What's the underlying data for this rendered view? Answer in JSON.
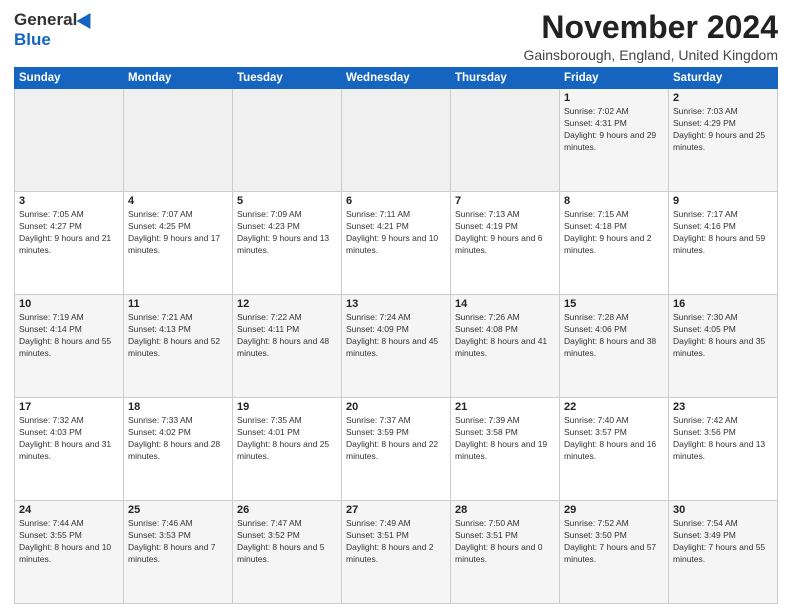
{
  "logo": {
    "general": "General",
    "blue": "Blue"
  },
  "header": {
    "month_title": "November 2024",
    "location": "Gainsborough, England, United Kingdom"
  },
  "days_of_week": [
    "Sunday",
    "Monday",
    "Tuesday",
    "Wednesday",
    "Thursday",
    "Friday",
    "Saturday"
  ],
  "weeks": [
    [
      {
        "day": "",
        "info": ""
      },
      {
        "day": "",
        "info": ""
      },
      {
        "day": "",
        "info": ""
      },
      {
        "day": "",
        "info": ""
      },
      {
        "day": "",
        "info": ""
      },
      {
        "day": "1",
        "info": "Sunrise: 7:02 AM\nSunset: 4:31 PM\nDaylight: 9 hours and 29 minutes."
      },
      {
        "day": "2",
        "info": "Sunrise: 7:03 AM\nSunset: 4:29 PM\nDaylight: 9 hours and 25 minutes."
      }
    ],
    [
      {
        "day": "3",
        "info": "Sunrise: 7:05 AM\nSunset: 4:27 PM\nDaylight: 9 hours and 21 minutes."
      },
      {
        "day": "4",
        "info": "Sunrise: 7:07 AM\nSunset: 4:25 PM\nDaylight: 9 hours and 17 minutes."
      },
      {
        "day": "5",
        "info": "Sunrise: 7:09 AM\nSunset: 4:23 PM\nDaylight: 9 hours and 13 minutes."
      },
      {
        "day": "6",
        "info": "Sunrise: 7:11 AM\nSunset: 4:21 PM\nDaylight: 9 hours and 10 minutes."
      },
      {
        "day": "7",
        "info": "Sunrise: 7:13 AM\nSunset: 4:19 PM\nDaylight: 9 hours and 6 minutes."
      },
      {
        "day": "8",
        "info": "Sunrise: 7:15 AM\nSunset: 4:18 PM\nDaylight: 9 hours and 2 minutes."
      },
      {
        "day": "9",
        "info": "Sunrise: 7:17 AM\nSunset: 4:16 PM\nDaylight: 8 hours and 59 minutes."
      }
    ],
    [
      {
        "day": "10",
        "info": "Sunrise: 7:19 AM\nSunset: 4:14 PM\nDaylight: 8 hours and 55 minutes."
      },
      {
        "day": "11",
        "info": "Sunrise: 7:21 AM\nSunset: 4:13 PM\nDaylight: 8 hours and 52 minutes."
      },
      {
        "day": "12",
        "info": "Sunrise: 7:22 AM\nSunset: 4:11 PM\nDaylight: 8 hours and 48 minutes."
      },
      {
        "day": "13",
        "info": "Sunrise: 7:24 AM\nSunset: 4:09 PM\nDaylight: 8 hours and 45 minutes."
      },
      {
        "day": "14",
        "info": "Sunrise: 7:26 AM\nSunset: 4:08 PM\nDaylight: 8 hours and 41 minutes."
      },
      {
        "day": "15",
        "info": "Sunrise: 7:28 AM\nSunset: 4:06 PM\nDaylight: 8 hours and 38 minutes."
      },
      {
        "day": "16",
        "info": "Sunrise: 7:30 AM\nSunset: 4:05 PM\nDaylight: 8 hours and 35 minutes."
      }
    ],
    [
      {
        "day": "17",
        "info": "Sunrise: 7:32 AM\nSunset: 4:03 PM\nDaylight: 8 hours and 31 minutes."
      },
      {
        "day": "18",
        "info": "Sunrise: 7:33 AM\nSunset: 4:02 PM\nDaylight: 8 hours and 28 minutes."
      },
      {
        "day": "19",
        "info": "Sunrise: 7:35 AM\nSunset: 4:01 PM\nDaylight: 8 hours and 25 minutes."
      },
      {
        "day": "20",
        "info": "Sunrise: 7:37 AM\nSunset: 3:59 PM\nDaylight: 8 hours and 22 minutes."
      },
      {
        "day": "21",
        "info": "Sunrise: 7:39 AM\nSunset: 3:58 PM\nDaylight: 8 hours and 19 minutes."
      },
      {
        "day": "22",
        "info": "Sunrise: 7:40 AM\nSunset: 3:57 PM\nDaylight: 8 hours and 16 minutes."
      },
      {
        "day": "23",
        "info": "Sunrise: 7:42 AM\nSunset: 3:56 PM\nDaylight: 8 hours and 13 minutes."
      }
    ],
    [
      {
        "day": "24",
        "info": "Sunrise: 7:44 AM\nSunset: 3:55 PM\nDaylight: 8 hours and 10 minutes."
      },
      {
        "day": "25",
        "info": "Sunrise: 7:46 AM\nSunset: 3:53 PM\nDaylight: 8 hours and 7 minutes."
      },
      {
        "day": "26",
        "info": "Sunrise: 7:47 AM\nSunset: 3:52 PM\nDaylight: 8 hours and 5 minutes."
      },
      {
        "day": "27",
        "info": "Sunrise: 7:49 AM\nSunset: 3:51 PM\nDaylight: 8 hours and 2 minutes."
      },
      {
        "day": "28",
        "info": "Sunrise: 7:50 AM\nSunset: 3:51 PM\nDaylight: 8 hours and 0 minutes."
      },
      {
        "day": "29",
        "info": "Sunrise: 7:52 AM\nSunset: 3:50 PM\nDaylight: 7 hours and 57 minutes."
      },
      {
        "day": "30",
        "info": "Sunrise: 7:54 AM\nSunset: 3:49 PM\nDaylight: 7 hours and 55 minutes."
      }
    ]
  ]
}
